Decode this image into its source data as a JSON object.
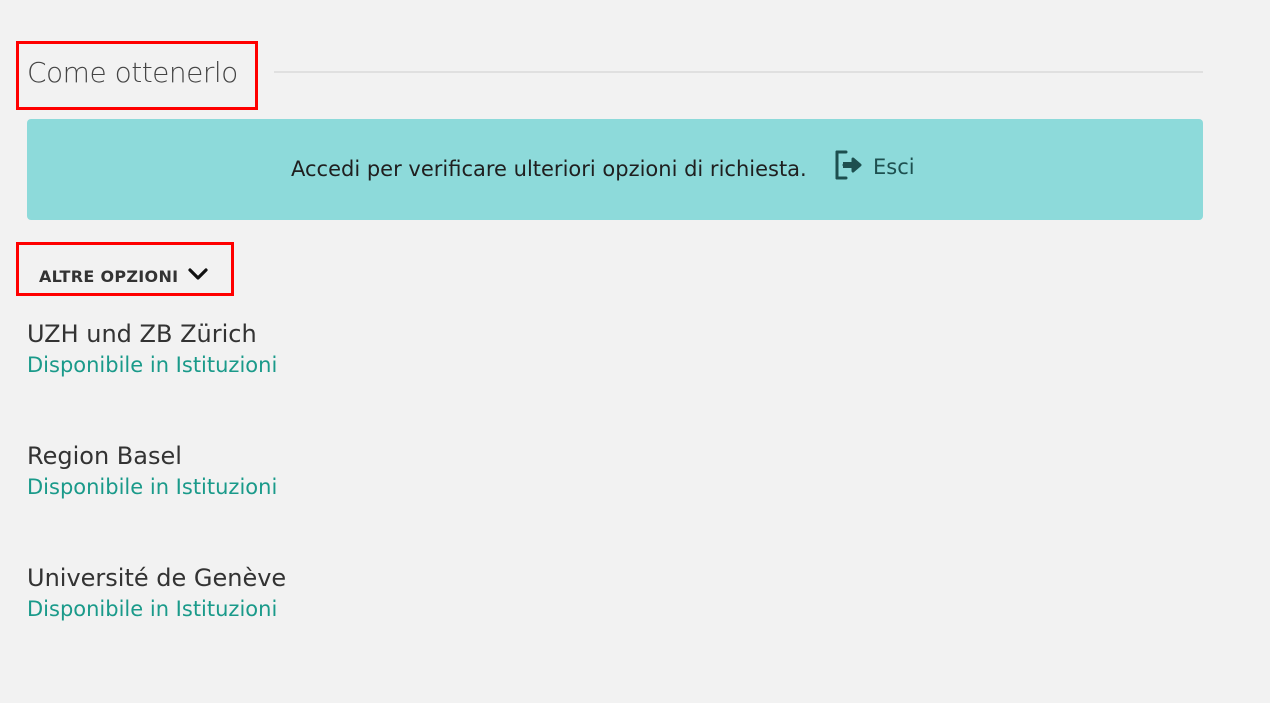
{
  "section": {
    "title": "Come ottenerlo"
  },
  "banner": {
    "message": "Accedi per verificare ulteriori opzioni di richiesta.",
    "logout_label": "Esci",
    "logout_icon": "sign-out-icon",
    "background_color": "#8ddada"
  },
  "other_options": {
    "label": "ALTRE OPZIONI",
    "icon": "chevron-down-icon"
  },
  "institutions": [
    {
      "name": "UZH und ZB Zürich",
      "availability": "Disponibile in Istituzioni"
    },
    {
      "name": "Region Basel",
      "availability": "Disponibile in Istituzioni"
    },
    {
      "name": "Université de Genève",
      "availability": "Disponibile in Istituzioni"
    }
  ],
  "colors": {
    "highlight_border": "#ff0000",
    "link": "#1a9a8a",
    "page_background": "#f2f2f2"
  }
}
